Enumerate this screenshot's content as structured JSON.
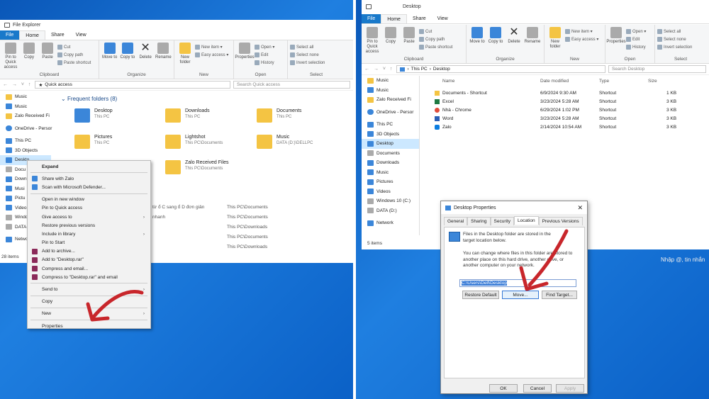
{
  "left": {
    "window_title": "File Explorer",
    "tabs": [
      "File",
      "Home",
      "Share",
      "View"
    ],
    "ribbon": {
      "clipboard": {
        "pin": "Pin to Quick access",
        "copy": "Copy",
        "paste": "Paste",
        "cut": "Cut",
        "copy_path": "Copy path",
        "paste_shortcut": "Paste shortcut",
        "label": "Clipboard"
      },
      "organize": {
        "move_to": "Move to",
        "copy_to": "Copy to",
        "delete": "Delete",
        "rename": "Rename",
        "label": "Organize"
      },
      "new": {
        "new_folder": "New folder",
        "new_item": "New item ▾",
        "easy_access": "Easy access ▾",
        "label": "New"
      },
      "open": {
        "properties": "Properties",
        "open": "Open ▾",
        "edit": "Edit",
        "history": "History",
        "label": "Open"
      },
      "select": {
        "select_all": "Select all",
        "select_none": "Select none",
        "invert": "Invert selection",
        "label": "Select"
      }
    },
    "address": "Quick access",
    "search_placeholder": "Search Quick access",
    "nav": [
      "Music",
      "Music",
      "Zalo Received Fi",
      "OneDrive - Persor",
      "This PC",
      "3D Objects",
      "Deskto",
      "Docu",
      "Down",
      "Musi",
      "Pictu",
      "Video",
      "Windo",
      "DATA",
      "Netwo"
    ],
    "frequent_header": "Frequent folders (8)",
    "folders": [
      {
        "name": "Desktop",
        "sub": "This PC"
      },
      {
        "name": "Downloads",
        "sub": "This PC"
      },
      {
        "name": "Documents",
        "sub": "This PC"
      },
      {
        "name": "Pictures",
        "sub": "This PC"
      },
      {
        "name": "Lightshot",
        "sub": "This PC\\Documents"
      },
      {
        "name": "Music",
        "sub": "DATA (D:)\\DELLPC"
      },
      {
        "name": "Zalo Received Files",
        "sub": "This PC\\Documents"
      }
    ],
    "recent": [
      {
        "name": "từ ổ C sang ổ D đơn giản",
        "path": "This PC\\Documents"
      },
      {
        "name": "nhanh",
        "path": "This PC\\Documents"
      },
      {
        "name": "",
        "path": "This PC\\Downloads"
      },
      {
        "name": "",
        "path": "This PC\\Documents"
      },
      {
        "name": "",
        "path": "This PC\\Downloads"
      }
    ],
    "status": "28 items",
    "context_menu": [
      "Expand",
      "Share with Zalo",
      "Scan with Microsoft Defender...",
      "Open in new window",
      "Pin to Quick access",
      "Give access to",
      "Restore previous versions",
      "Include in library",
      "Pin to Start",
      "Add to archive...",
      "Add to \"Desktop.rar\"",
      "Compress and email...",
      "Compress to \"Desktop.rar\" and email",
      "Send to",
      "Copy",
      "New",
      "Properties"
    ]
  },
  "right": {
    "window_title": "Desktop",
    "tabs": [
      "File",
      "Home",
      "Share",
      "View"
    ],
    "ribbon": {
      "pin": "Pin to Quick access",
      "copy": "Copy",
      "paste": "Paste",
      "cut": "Cut",
      "copy_path": "Copy path",
      "paste_shortcut": "Paste shortcut",
      "clipboard": "Clipboard",
      "move_to": "Move to",
      "copy_to": "Copy to",
      "delete": "Delete",
      "rename": "Rename",
      "organize": "Organize",
      "new_folder": "New folder",
      "new_item": "New item ▾",
      "easy_access": "Easy access ▾",
      "new": "New",
      "properties": "Properties",
      "open": "Open ▾",
      "edit": "Edit",
      "history": "History",
      "open_label": "Open",
      "select_all": "Select all",
      "select_none": "Select none",
      "invert": "Invert selection",
      "select": "Select"
    },
    "address": [
      "This PC",
      "Desktop"
    ],
    "search_placeholder": "Search Desktop",
    "nav": [
      "Music",
      "Music",
      "Zalo Received Fi",
      "OneDrive - Persor",
      "This PC",
      "3D Objects",
      "Desktop",
      "Documents",
      "Downloads",
      "Music",
      "Pictures",
      "Videos",
      "Windows 10 (C:)",
      "DATA (D:)",
      "Network"
    ],
    "columns": [
      "Name",
      "Date modified",
      "Type",
      "Size"
    ],
    "files": [
      {
        "name": "Documents - Shortcut",
        "date": "6/9/2024 9:30 AM",
        "type": "Shortcut",
        "size": "1 KB"
      },
      {
        "name": "Excel",
        "date": "3/23/2024 5:28 AM",
        "type": "Shortcut",
        "size": "3 KB"
      },
      {
        "name": "Nhà - Chrome",
        "date": "6/29/2024 1:02 PM",
        "type": "Shortcut",
        "size": "3 KB"
      },
      {
        "name": "Word",
        "date": "3/23/2024 5:28 AM",
        "type": "Shortcut",
        "size": "3 KB"
      },
      {
        "name": "Zalo",
        "date": "2/14/2024 10:54 AM",
        "type": "Shortcut",
        "size": "3 KB"
      }
    ],
    "status": "5 items",
    "chat_hint": "Nhập @, tin nhắn",
    "dialog": {
      "title": "Desktop Properties",
      "tabs": [
        "General",
        "Sharing",
        "Security",
        "Location",
        "Previous Versions"
      ],
      "text1": "Files in the Desktop folder are stored in the target location below.",
      "text2": "You can change where files in this folder are stored to another place on this hard drive, another drive, or another computer on your network.",
      "path": "C:\\Users\\Dell\\Desktop",
      "restore": "Restore Default",
      "move": "Move...",
      "find": "Find Target...",
      "ok": "OK",
      "cancel": "Cancel",
      "apply": "Apply"
    }
  },
  "colors": {
    "accent": "#1979ca",
    "desktop": "#1565c8",
    "arrow": "#c8262b",
    "selection": "#cce8ff"
  }
}
